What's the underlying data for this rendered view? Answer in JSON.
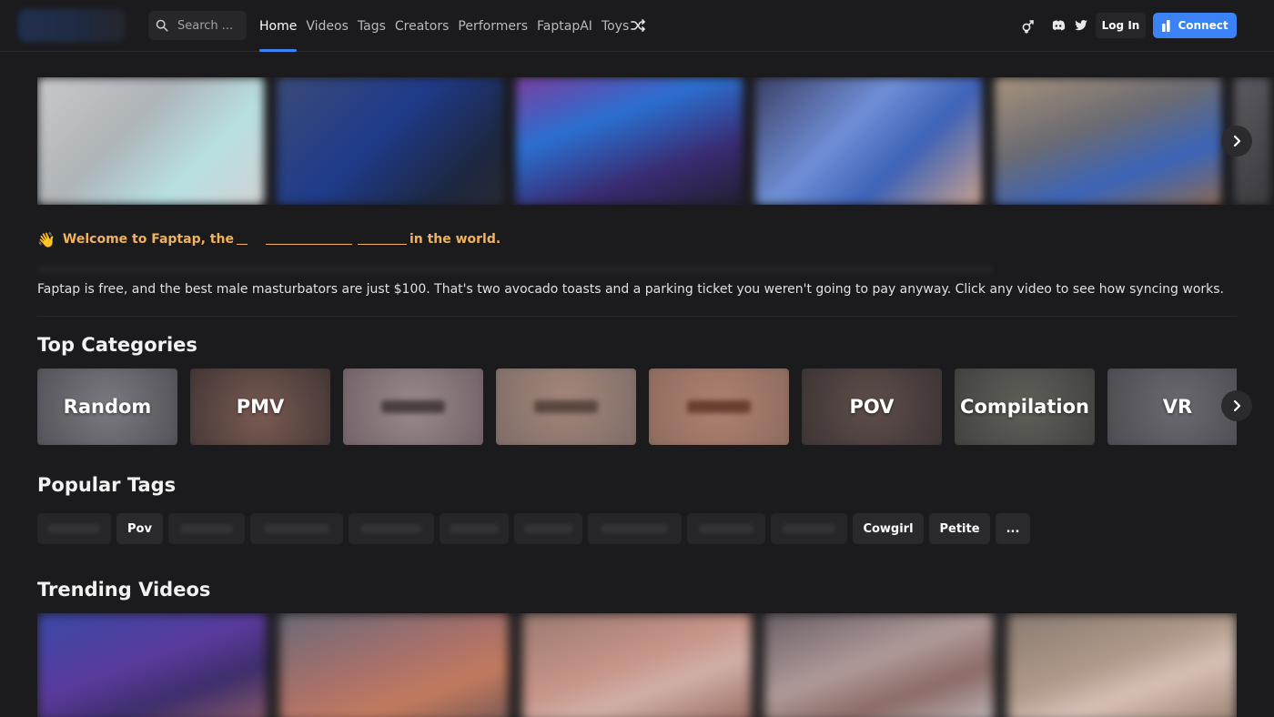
{
  "header": {
    "search_placeholder": "Search ...",
    "nav": [
      "Home",
      "Videos",
      "Tags",
      "Creators",
      "Performers",
      "FaptapAI",
      "Toys"
    ],
    "active_nav": "Home",
    "login_label": "Log In",
    "connect_label": "Connect"
  },
  "welcome": {
    "emoji": "👋",
    "prefix": "Welcome to Faptap, the",
    "suffix": "in the world."
  },
  "intro": "Faptap is free, and the best male masturbators are just $100. That's two avocado toasts and a parking ticket you weren't going to pay anyway. Click any video to see how syncing works.",
  "sections": {
    "categories_title": "Top Categories",
    "tags_title": "Popular Tags",
    "trending_title": "Trending Videos"
  },
  "categories": [
    {
      "label": "Random",
      "visible": true
    },
    {
      "label": "PMV",
      "visible": true
    },
    {
      "label": "",
      "visible": false
    },
    {
      "label": "",
      "visible": false
    },
    {
      "label": "",
      "visible": false
    },
    {
      "label": "POV",
      "visible": true
    },
    {
      "label": "Compilation",
      "visible": true
    },
    {
      "label": "VR",
      "visible": true
    }
  ],
  "tags": [
    "",
    "Pov",
    "",
    "",
    "",
    "",
    "",
    "",
    "",
    "",
    "Cowgirl",
    "Petite",
    "..."
  ],
  "colors": {
    "accent": "#3b82f6",
    "welcome": "#f0b35c",
    "background": "#1b1b1e"
  }
}
